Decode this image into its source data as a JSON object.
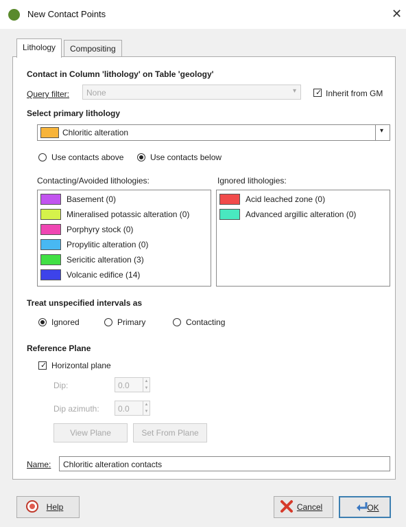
{
  "window": {
    "title": "New Contact Points"
  },
  "tabs": [
    {
      "label": "Lithology"
    },
    {
      "label": "Compositing"
    }
  ],
  "contact_heading": "Contact in Column 'lithology' on Table 'geology'",
  "query_filter": {
    "label": "Query filter:",
    "value": "None"
  },
  "inherit": {
    "label": "Inherit from GM",
    "checked": true
  },
  "primary": {
    "heading": "Select primary lithology",
    "selected": "Chloritic alteration",
    "color": "#f7b43a"
  },
  "contacts_mode": {
    "above_label": "Use contacts above",
    "below_label": "Use contacts below",
    "selected": "below"
  },
  "contacting": {
    "heading": "Contacting/Avoided lithologies:",
    "items": [
      {
        "label": "Basement (0)",
        "color": "#c254ef"
      },
      {
        "label": "Mineralised potassic alteration (0)",
        "color": "#d5f24b"
      },
      {
        "label": "Porphyry stock (0)",
        "color": "#ef46b3"
      },
      {
        "label": "Propylitic alteration (0)",
        "color": "#48b8f2"
      },
      {
        "label": "Sericitic alteration (3)",
        "color": "#41e044"
      },
      {
        "label": "Volcanic edifice (14)",
        "color": "#3d43ea"
      }
    ]
  },
  "ignored": {
    "heading": "Ignored lithologies:",
    "items": [
      {
        "label": "Acid leached zone (0)",
        "color": "#f14b4b"
      },
      {
        "label": "Advanced argillic alteration (0)",
        "color": "#49e8c0"
      }
    ]
  },
  "unspecified": {
    "heading": "Treat unspecified intervals as",
    "options": [
      "Ignored",
      "Primary",
      "Contacting"
    ],
    "selected": "Ignored"
  },
  "reference_plane": {
    "heading": "Reference Plane",
    "horizontal_label": "Horizontal plane",
    "horizontal_checked": true,
    "dip_label": "Dip:",
    "dip_value": "0.0",
    "dip_azimuth_label": "Dip azimuth:",
    "dip_azimuth_value": "0.0",
    "view_plane_label": "View Plane",
    "set_from_plane_label": "Set From Plane"
  },
  "name": {
    "label": "Name:",
    "value": "Chloritic alteration contacts"
  },
  "buttons": {
    "help": "Help",
    "cancel": "Cancel",
    "ok": "OK"
  }
}
